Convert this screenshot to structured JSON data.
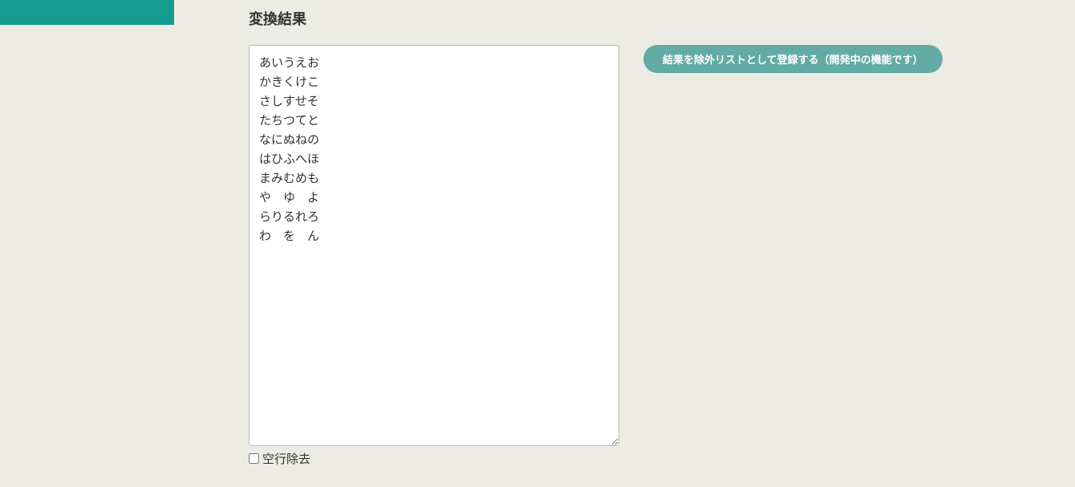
{
  "heading": "変換結果",
  "result_text": "あいうえお\nかきくけこ\nさしすせそ\nたちつてと\nなにぬねの\nはひふへほ\nまみむめも\nや　ゆ　よ\nらりるれろ\nわ　を　ん",
  "checkbox_label": "空行除去",
  "register_button_label": "結果を除外リストとして登録する（開発中の機能です）"
}
